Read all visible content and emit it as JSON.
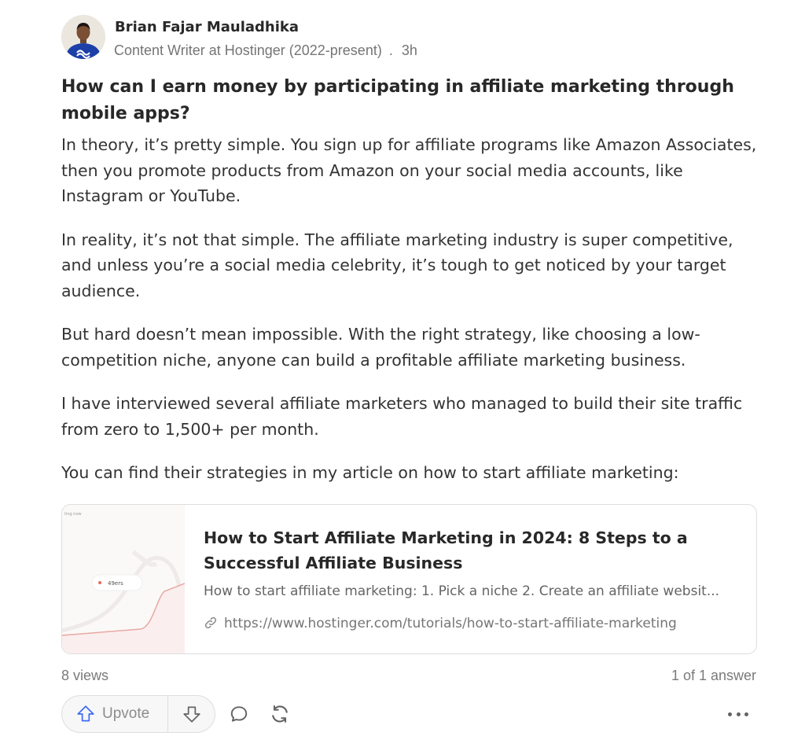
{
  "author": {
    "name": "Brian Fajar Mauladhika",
    "credential": "Content Writer at Hostinger (2022-present)",
    "separator": ".",
    "time": "3h"
  },
  "question": "How can I earn money by participating in affiliate marketing through mobile apps?",
  "paragraphs": [
    "In theory, it’s pretty simple. You sign up for affiliate programs like Amazon Associates, then you promote products from Amazon on your social media accounts, like Instagram or YouTube.",
    "In reality, it’s not that simple. The affiliate marketing industry is super competitive, and unless you’re a social media celebrity, it’s tough to get noticed by your target audience.",
    "But hard doesn’t mean impossible. With the right strategy, like choosing a low-competition niche, anyone can build a profitable affiliate marketing business.",
    "I have interviewed several affiliate marketers who managed to build their site traffic from zero to 1,500+ per month.",
    "You can find their strategies in my article on how to start affiliate marketing:"
  ],
  "link_card": {
    "title": "How to Start Affiliate Marketing in 2024: 8 Steps to a Successful Affiliate Business",
    "description": "How to start affiliate marketing: 1. Pick a niche 2. Create an affiliate websit...",
    "url": "https://www.hostinger.com/tutorials/how-to-start-affiliate-marketing",
    "thumb_caption": "ting now",
    "thumb_badge": "49ers"
  },
  "footer": {
    "views": "8 views",
    "answer_count": "1 of 1 answer"
  },
  "actions": {
    "upvote_label": "Upvote",
    "upvote_icon": "arrow-up-icon",
    "downvote_icon": "arrow-down-icon",
    "comment_icon": "comment-bubble-icon",
    "share_icon": "share-reshare-icon",
    "more_icon": "more-dots-icon"
  },
  "colors": {
    "text_primary": "#282829",
    "text_secondary": "#757575",
    "accent": "#2e69ff",
    "border": "#dedede"
  }
}
